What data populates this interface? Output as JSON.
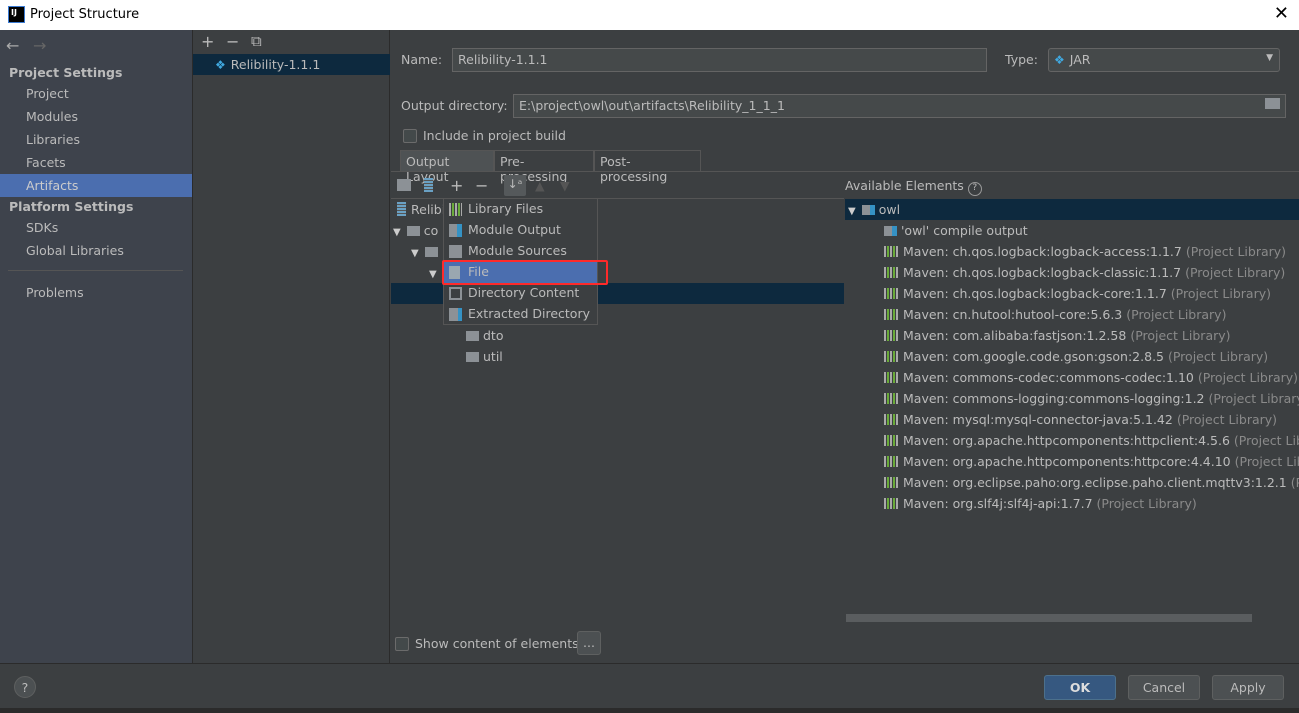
{
  "window": {
    "title": "Project Structure",
    "close": "✕"
  },
  "sidebar": {
    "back": "←",
    "forward": "→",
    "project_settings": "Project Settings",
    "project_items": [
      "Project",
      "Modules",
      "Libraries",
      "Facets",
      "Artifacts"
    ],
    "selected": "Artifacts",
    "platform_settings": "Platform Settings",
    "platform_items": [
      "SDKs",
      "Global Libraries"
    ],
    "problems": "Problems"
  },
  "artifact_list": {
    "toolbar": [
      "+",
      "−",
      "⧉"
    ],
    "items": [
      "Relibility-1.1.1"
    ]
  },
  "form": {
    "name_label": "Name:",
    "name_value": "Relibility-1.1.1",
    "type_label": "Type:",
    "type_value": "JAR",
    "output_label": "Output directory:",
    "output_value": "E:\\project\\owl\\out\\artifacts\\Relibility_1_1_1",
    "include_label": "Include in project build",
    "include_checked": false
  },
  "tabs": [
    "Output Layout",
    "Pre-processing",
    "Post-processing"
  ],
  "layout_tree": {
    "rows": [
      "Relibi",
      "co",
      "dto",
      "util"
    ]
  },
  "add_menu": {
    "items": [
      "Library Files",
      "Module Output",
      "Module Sources",
      "File",
      "Directory Content",
      "Extracted Directory"
    ],
    "highlighted": "File"
  },
  "available": {
    "title": "Available Elements",
    "root": "owl",
    "compile_output": "'owl' compile output",
    "suffix": "(Project Library)",
    "libraries": [
      "Maven: ch.qos.logback:logback-access:1.1.7",
      "Maven: ch.qos.logback:logback-classic:1.1.7",
      "Maven: ch.qos.logback:logback-core:1.1.7",
      "Maven: cn.hutool:hutool-core:5.6.3",
      "Maven: com.alibaba:fastjson:1.2.58",
      "Maven: com.google.code.gson:gson:2.8.5",
      "Maven: commons-codec:commons-codec:1.10",
      "Maven: commons-logging:commons-logging:1.2",
      "Maven: mysql:mysql-connector-java:5.1.42",
      "Maven: org.apache.httpcomponents:httpclient:4.5.6",
      "Maven: org.apache.httpcomponents:httpcore:4.4.10",
      "Maven: org.eclipse.paho:org.eclipse.paho.client.mqttv3:1.2.1",
      "Maven: org.slf4j:slf4j-api:1.7.7"
    ],
    "last_suffix": "(Project"
  },
  "show_content_label": "Show content of elements",
  "ellipsis": "...",
  "buttons": {
    "help": "?",
    "ok": "OK",
    "cancel": "Cancel",
    "apply": "Apply"
  },
  "colors": {
    "accent": "#4b6eaf",
    "highlight_box": "#ff2a2a",
    "selection": "#0d293e"
  }
}
